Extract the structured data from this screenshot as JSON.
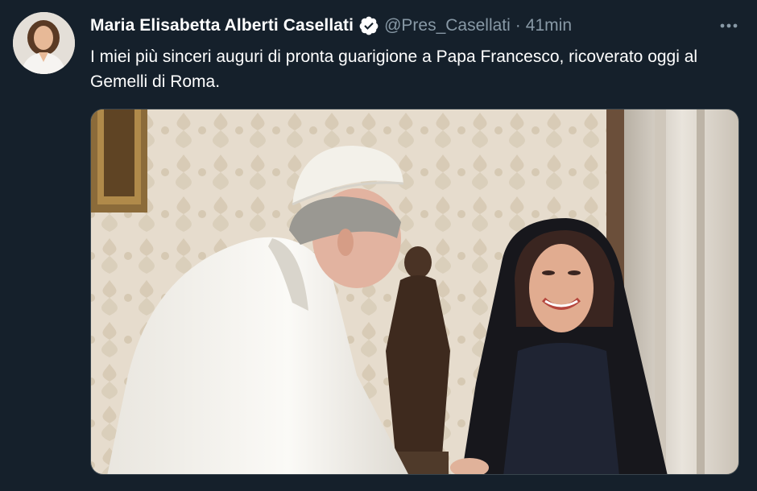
{
  "tweet": {
    "author": {
      "display_name": "Maria Elisabetta Alberti Casellati",
      "handle": "@Pres_Casellati",
      "verified": true,
      "avatar_icon": "profile-photo"
    },
    "separator": "·",
    "time": "41min",
    "text": "I miei più sinceri auguri di pronta guarigione a Papa Francesco, ricoverato oggi al Gemelli di Roma.",
    "more_icon": "ellipsis-icon",
    "verified_icon": "verified-badge-icon"
  },
  "colors": {
    "background": "#15202b",
    "text_primary": "#ffffff",
    "text_secondary": "#8899a6",
    "border": "#38444d"
  }
}
